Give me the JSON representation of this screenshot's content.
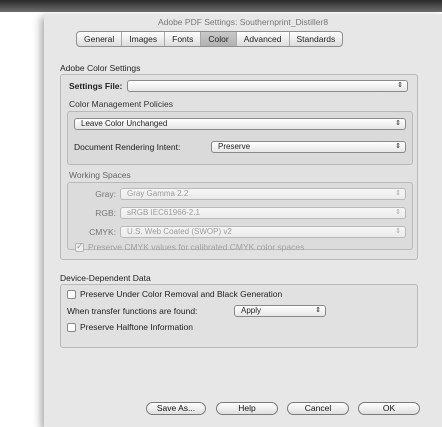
{
  "window": {
    "title": "Adobe PDF Settings: Southernprint_Distiller8"
  },
  "tabs": [
    {
      "label": "General"
    },
    {
      "label": "Images"
    },
    {
      "label": "Fonts"
    },
    {
      "label": "Color"
    },
    {
      "label": "Advanced"
    },
    {
      "label": "Standards"
    }
  ],
  "selected_tab": "Color",
  "color_settings": {
    "group_label": "Adobe Color Settings",
    "settings_file_label": "Settings File:",
    "settings_file_value": "",
    "policies_label": "Color Management Policies",
    "policy_value": "Leave Color Unchanged",
    "intent_label": "Document Rendering Intent:",
    "intent_value": "Preserve",
    "working_spaces_label": "Working Spaces",
    "gray_label": "Gray:",
    "gray_value": "Gray Gamma 2.2",
    "rgb_label": "RGB:",
    "rgb_value": "sRGB IEC61966-2.1",
    "cmyk_label": "CMYK:",
    "cmyk_value": "U.S. Web Coated (SWOP) v2",
    "preserve_cmyk_label": "Preserve CMYK values for calibrated CMYK color spaces",
    "preserve_cmyk_checked": true
  },
  "device_data": {
    "group_label": "Device-Dependent Data",
    "ucr_label": "Preserve Under Color Removal and Black Generation",
    "ucr_checked": false,
    "transfer_label": "When transfer functions are found:",
    "transfer_value": "Apply",
    "halftone_label": "Preserve Halftone Information",
    "halftone_checked": false
  },
  "buttons": {
    "save_as": "Save As...",
    "help": "Help",
    "cancel": "Cancel",
    "ok": "OK"
  },
  "icons": {
    "popup_arrows": "⇕",
    "checkmark": "✓"
  },
  "colors": {
    "dialog_bg": "#e7e7e7",
    "group_bg": "#e1e1e1",
    "tab_selected_bg": "#b9b9b9"
  }
}
